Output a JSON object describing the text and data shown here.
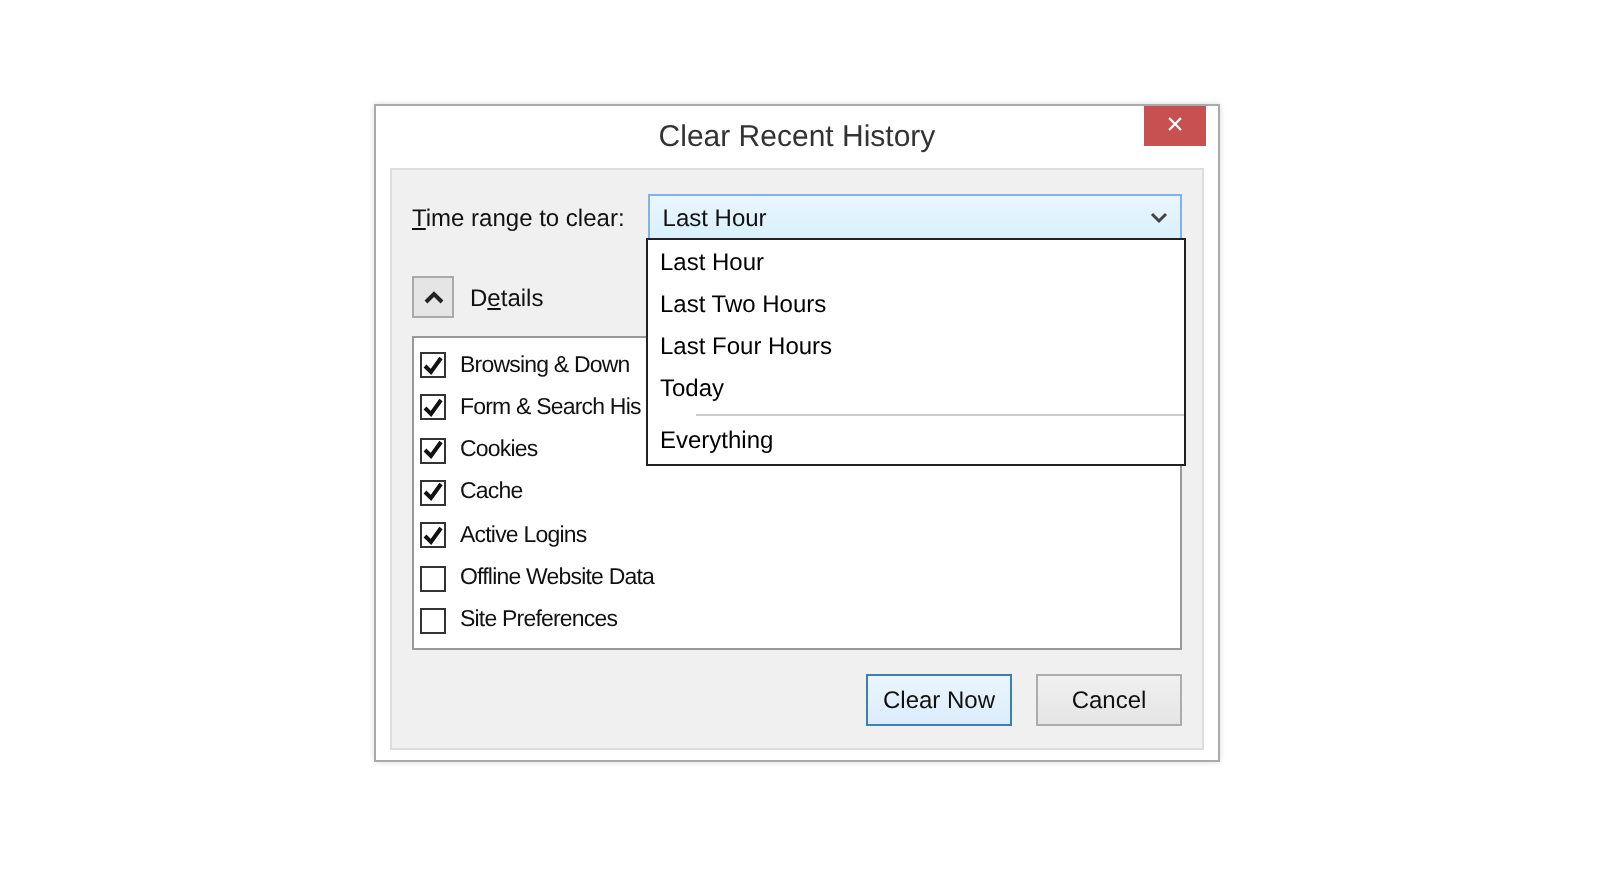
{
  "window": {
    "title": "Clear Recent History",
    "close": "×"
  },
  "time_range": {
    "label": "Time range to clear:",
    "value": "Last Hour",
    "expanded": true,
    "options": [
      {
        "label": "Last Hour",
        "separator_before": false
      },
      {
        "label": "Last Two Hours",
        "separator_before": false
      },
      {
        "label": "Last Four Hours",
        "separator_before": false
      },
      {
        "label": "Today",
        "separator_before": false
      },
      {
        "label": "Everything",
        "separator_before": true
      }
    ]
  },
  "details": {
    "label": "Details",
    "expanded": true
  },
  "items": [
    {
      "label": "Browsing & Down",
      "checked": true
    },
    {
      "label": "Form & Search His",
      "checked": true
    },
    {
      "label": "Cookies",
      "checked": true
    },
    {
      "label": "Cache",
      "checked": true
    },
    {
      "label": "Active Logins",
      "checked": true
    },
    {
      "label": "Offline Website Data",
      "checked": false
    },
    {
      "label": "Site Preferences",
      "checked": false
    }
  ],
  "buttons": [
    {
      "label": "Clear Now",
      "default": true
    },
    {
      "label": "Cancel",
      "default": false
    }
  ]
}
